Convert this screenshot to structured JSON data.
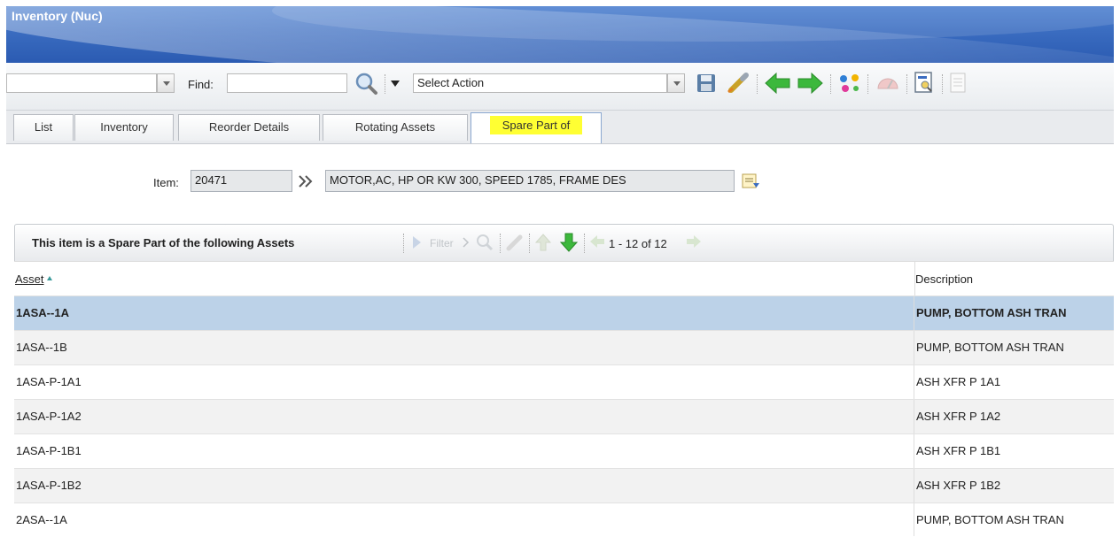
{
  "app": {
    "title": "Inventory (Nuc)"
  },
  "toolbar": {
    "query_value": "",
    "find_label": "Find:",
    "find_value": "",
    "action_select": "Select Action"
  },
  "tabs": [
    {
      "label": "List"
    },
    {
      "label": "Inventory"
    },
    {
      "label": "Reorder Details"
    },
    {
      "label": "Rotating Assets"
    },
    {
      "label": "Spare Part of"
    }
  ],
  "item": {
    "label": "Item:",
    "value": "20471",
    "description": "MOTOR,AC, HP OR KW 300, SPEED 1785, FRAME DES"
  },
  "table": {
    "title": "This item is a Spare Part of the following Assets",
    "filter_label": "Filter",
    "range_label": "1 - 12 of 12",
    "columns": {
      "asset": "Asset",
      "description": "Description"
    },
    "rows": [
      {
        "asset": "1ASA--1A",
        "description": "PUMP, BOTTOM ASH TRAN"
      },
      {
        "asset": "1ASA--1B",
        "description": "PUMP, BOTTOM ASH TRAN"
      },
      {
        "asset": "1ASA-P-1A1",
        "description": "ASH XFR P 1A1"
      },
      {
        "asset": "1ASA-P-1A2",
        "description": "ASH XFR P 1A2"
      },
      {
        "asset": "1ASA-P-1B1",
        "description": "ASH XFR P 1B1"
      },
      {
        "asset": "1ASA-P-1B2",
        "description": "ASH XFR P 1B2"
      },
      {
        "asset": "2ASA--1A",
        "description": "PUMP, BOTTOM ASH TRAN"
      }
    ]
  },
  "colors": {
    "banner": "#3a6cc0",
    "selected_row": "#bcd2e8",
    "active_tab_highlight": "#ffff33",
    "arrow_green": "#3cb83c"
  }
}
